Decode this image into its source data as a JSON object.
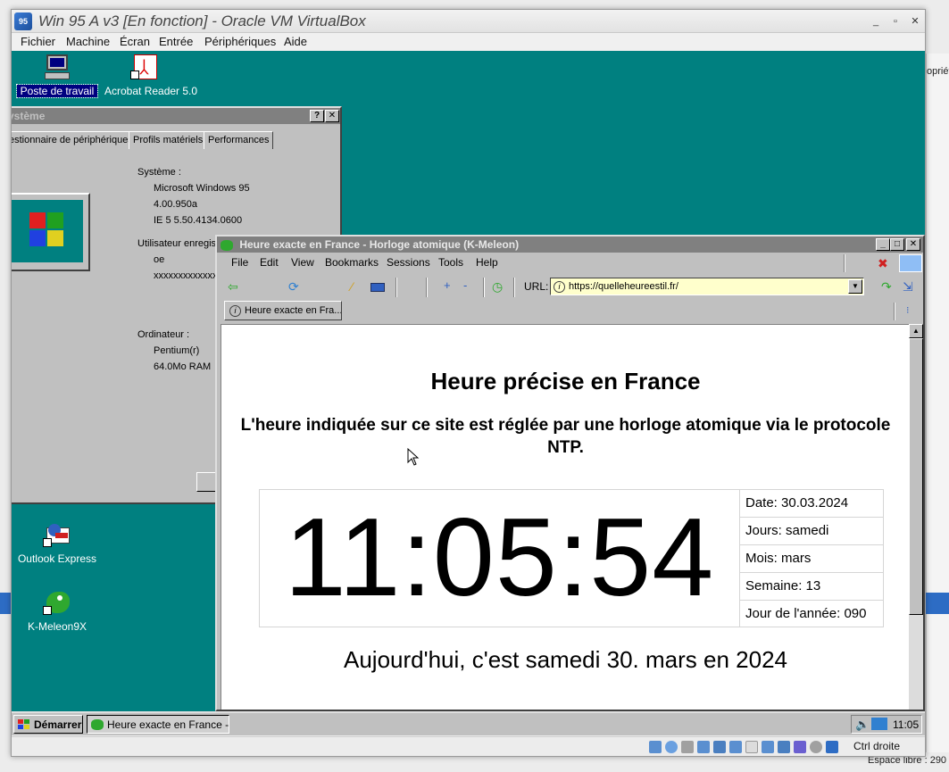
{
  "vbox": {
    "title": "Win 95 A v3 [En fonction] - Oracle VM VirtualBox",
    "menu": [
      "Fichier",
      "Machine",
      "Écran",
      "Entrée",
      "Périphériques",
      "Aide"
    ],
    "hostkey": "Ctrl droite"
  },
  "host": {
    "frag_right_top": "opriét",
    "frag_bottom": "Espace libre : 290"
  },
  "desktop": {
    "icons": [
      {
        "label": "Poste de travail",
        "icon": "my-computer-icon"
      },
      {
        "label": "Acrobat Reader 5.0",
        "icon": "acrobat-icon"
      },
      {
        "label": "Outlook Express",
        "icon": "outlook-express-icon"
      },
      {
        "label": "K-Meleon9X",
        "icon": "kmeleon-icon"
      }
    ]
  },
  "system_window": {
    "title": "ystème",
    "tabs": [
      "estionnaire de périphériques",
      "Profils matériels",
      "Performances"
    ],
    "system_label": "Système :",
    "os": "Microsoft Windows 95",
    "version": "4.00.950a",
    "ie": "IE 5 5.50.4134.0600",
    "user_label": "Utilisateur enregist",
    "user": "oe",
    "serial": "xxxxxxxxxxxxxxxx",
    "computer_label": "Ordinateur :",
    "cpu": "Pentium(r)",
    "ram": "64.0Mo RAM"
  },
  "browser": {
    "title": "Heure exacte en France - Horloge atomique (K-Meleon)",
    "menu": [
      "File",
      "Edit",
      "View",
      "Bookmarks",
      "Sessions",
      "Tools",
      "Help"
    ],
    "url_label": "URL:",
    "url": "https://quelleheureestil.fr/",
    "tab_label": "Heure exacte en Fra...",
    "zoom_in": "+",
    "zoom_out": "-"
  },
  "page": {
    "heading": "Heure précise en France",
    "subheading": "L'heure indiquée sur ce site est réglée par une horloge atomique via le protocole NTP.",
    "clock": "11:05:54",
    "info": [
      "Date: 30.03.2024",
      "Jours: samedi",
      "Mois: mars",
      "Semaine: 13",
      "Jour de l'année: 090"
    ],
    "today": "Aujourd'hui, c'est samedi 30. mars en 2024"
  },
  "taskbar": {
    "start": "Démarrer",
    "task": "Heure exacte en France - ...",
    "time": "11:05"
  },
  "colors": {
    "desktop": "#008080",
    "win95_gray": "#c0c0c0",
    "url_bg": "#ffffcc"
  }
}
